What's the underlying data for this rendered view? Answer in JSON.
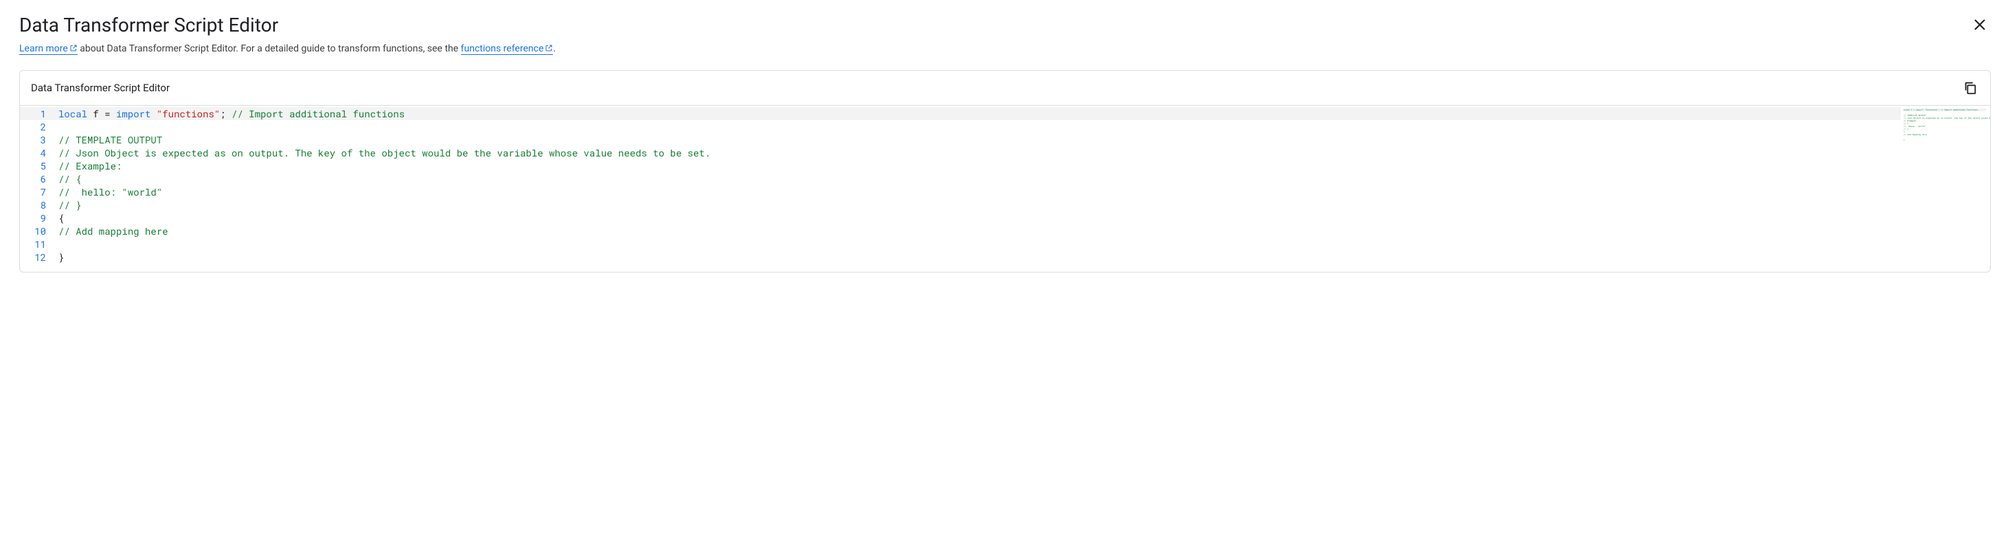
{
  "header": {
    "title": "Data Transformer Script Editor"
  },
  "subtitle": {
    "learn_more_label": "Learn more",
    "text_middle": " about Data Transformer Script Editor. For a detailed guide to transform functions, see the ",
    "functions_ref_label": "functions reference",
    "text_end": "."
  },
  "panel": {
    "title": "Data Transformer Script Editor"
  },
  "code": {
    "lines": [
      {
        "n": 1,
        "hl": true,
        "tokens": [
          {
            "t": "local",
            "c": "keyword"
          },
          {
            "t": " f = ",
            "c": "plain"
          },
          {
            "t": "import",
            "c": "keyword"
          },
          {
            "t": " ",
            "c": "plain"
          },
          {
            "t": "\"functions\"",
            "c": "string"
          },
          {
            "t": "; ",
            "c": "plain"
          },
          {
            "t": "// Import additional functions",
            "c": "comment"
          }
        ]
      },
      {
        "n": 2,
        "tokens": []
      },
      {
        "n": 3,
        "tokens": [
          {
            "t": "// TEMPLATE OUTPUT",
            "c": "comment"
          }
        ]
      },
      {
        "n": 4,
        "tokens": [
          {
            "t": "// Json Object is expected as on output. The key of the object would be the variable whose value needs to be set.",
            "c": "comment"
          }
        ]
      },
      {
        "n": 5,
        "tokens": [
          {
            "t": "// Example:",
            "c": "comment"
          }
        ]
      },
      {
        "n": 6,
        "tokens": [
          {
            "t": "// {",
            "c": "comment"
          }
        ]
      },
      {
        "n": 7,
        "tokens": [
          {
            "t": "//  hello: \"world\"",
            "c": "comment"
          }
        ]
      },
      {
        "n": 8,
        "tokens": [
          {
            "t": "// }",
            "c": "comment"
          }
        ]
      },
      {
        "n": 9,
        "tokens": [
          {
            "t": "{",
            "c": "plain"
          }
        ]
      },
      {
        "n": 10,
        "tokens": [
          {
            "t": "// Add mapping here",
            "c": "comment"
          }
        ]
      },
      {
        "n": 11,
        "tokens": []
      },
      {
        "n": 12,
        "tokens": [
          {
            "t": "}",
            "c": "plain"
          }
        ]
      }
    ]
  },
  "minimap_text": "local f = import \"functions\"; // Import additional functions\n\n// TEMPLATE OUTPUT\n// Json Object is expected as on output. The key of the object would be the variable whose value needs to be set.\n// Example:\n// {\n//  hello: \"world\"\n// }\n{\n// Add mapping here\n\n}"
}
